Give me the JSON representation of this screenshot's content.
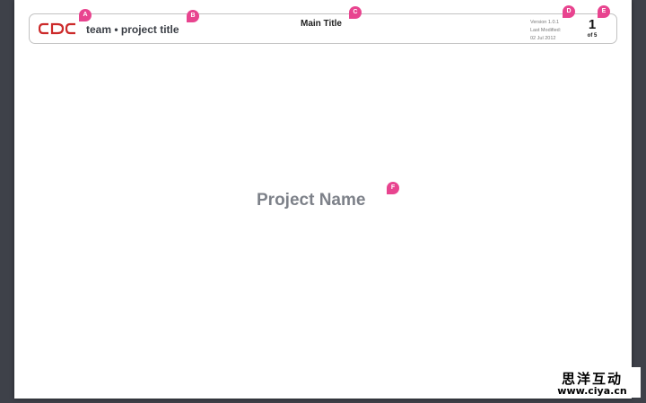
{
  "header": {
    "logo_text": "CDC",
    "team_project": "team • project title",
    "main_title": "Main Title",
    "version": "Version 1.0.1",
    "last_modified_label": "Last Modified:",
    "last_modified_date": "02 Jul 2012",
    "page_number": "1",
    "page_total": "of 5"
  },
  "body": {
    "project_name": "Project Name"
  },
  "markers": [
    "A",
    "B",
    "C",
    "D",
    "E",
    "F"
  ],
  "watermark": {
    "chinese": "思洋互动",
    "url": "www.ciya.cn"
  },
  "colors": {
    "background": "#3e4149",
    "marker": "#e8448f",
    "logo": "#cc2a2a",
    "project_name": "#7d8189"
  }
}
